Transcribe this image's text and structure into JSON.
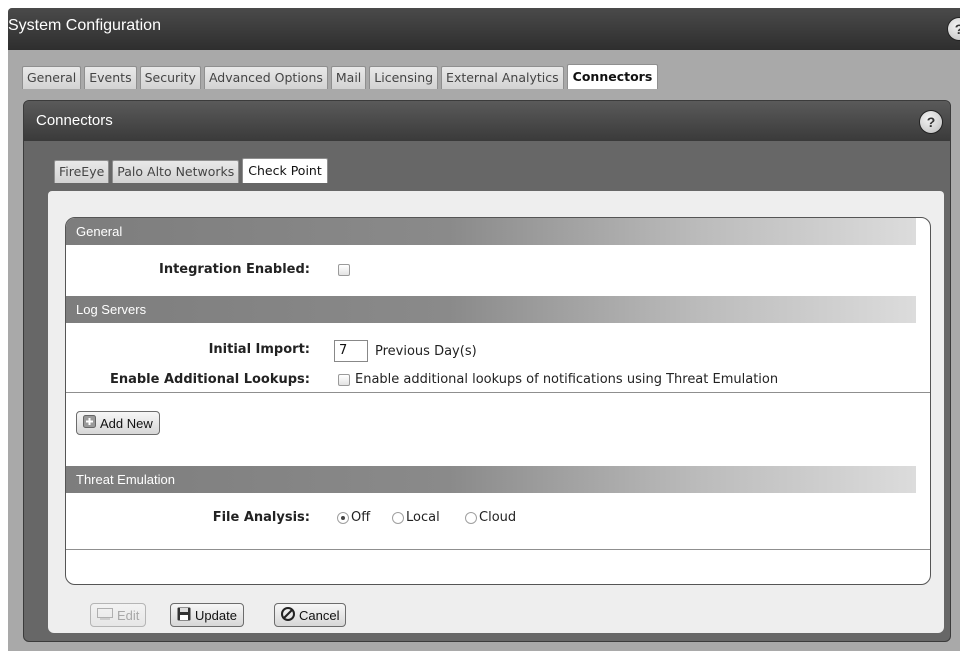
{
  "window": {
    "title": "System Configuration",
    "help": "?"
  },
  "main_tabs": [
    {
      "label": "General",
      "active": false
    },
    {
      "label": "Events",
      "active": false
    },
    {
      "label": "Security",
      "active": false
    },
    {
      "label": "Advanced Options",
      "active": false
    },
    {
      "label": "Mail",
      "active": false
    },
    {
      "label": "Licensing",
      "active": false
    },
    {
      "label": "External Analytics",
      "active": false
    },
    {
      "label": "Connectors",
      "active": true
    }
  ],
  "panel": {
    "title": "Connectors",
    "help": "?"
  },
  "sub_tabs": [
    {
      "label": "FireEye",
      "active": false
    },
    {
      "label": "Palo Alto Networks",
      "active": false
    },
    {
      "label": "Check Point",
      "active": true
    }
  ],
  "sections": {
    "general": {
      "title": "General",
      "integration_label": "Integration Enabled:",
      "integration_checked": false
    },
    "log_servers": {
      "title": "Log Servers",
      "initial_import_label": "Initial Import:",
      "initial_import_value": "7",
      "initial_import_unit": "Previous Day(s)",
      "lookups_label": "Enable Additional Lookups:",
      "lookups_text": "Enable additional lookups of notifications using Threat Emulation",
      "lookups_checked": false,
      "add_new": "Add New"
    },
    "threat_emulation": {
      "title": "Threat Emulation",
      "file_analysis_label": "File Analysis:",
      "options": [
        "Off",
        "Local",
        "Cloud"
      ],
      "selected": "Off"
    }
  },
  "footer_buttons": {
    "edit": "Edit",
    "update": "Update",
    "cancel": "Cancel"
  }
}
